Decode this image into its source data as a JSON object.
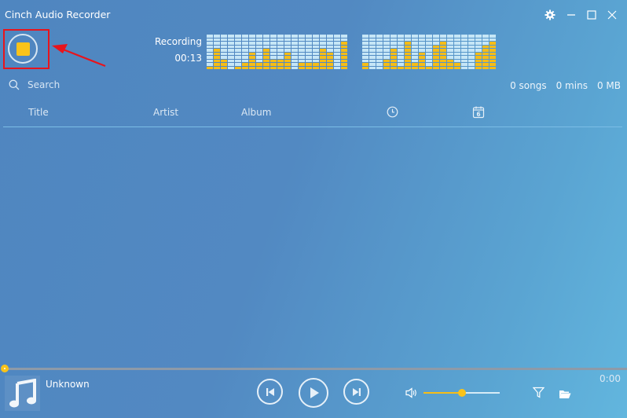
{
  "window": {
    "title": "Cinch Audio Recorder",
    "controls": [
      "settings-icon",
      "minimize-icon",
      "maximize-icon",
      "close-icon"
    ]
  },
  "recorder": {
    "status_label": "Recording",
    "elapsed": "00:13",
    "stop_button_icon": "stop-icon",
    "annotation": "red-highlight-box-with-arrow"
  },
  "meters": {
    "segments_per_column": 10,
    "left_levels": [
      1,
      6,
      3,
      0,
      1,
      2,
      5,
      2,
      6,
      3,
      3,
      5,
      0,
      2,
      2,
      2,
      6,
      5,
      0,
      8
    ],
    "right_levels": [
      2,
      0,
      0,
      3,
      6,
      1,
      8,
      2,
      5,
      1,
      7,
      8,
      3,
      2,
      0,
      0,
      5,
      7,
      8
    ],
    "colors": {
      "on": "#f6bd17",
      "off": "#c6e6f6"
    }
  },
  "search": {
    "placeholder": "Search",
    "icon": "search-icon"
  },
  "stats": {
    "songs": "0 songs",
    "mins": "0 mins",
    "size": "0 MB"
  },
  "columns": {
    "title": "Title",
    "artist": "Artist",
    "album": "Album",
    "duration_icon": "clock-icon",
    "date_icon": "calendar-icon",
    "calendar_day": "6"
  },
  "player": {
    "track_name": "Unknown",
    "time": "0:00",
    "progress_percent": 0,
    "volume_percent": 50,
    "accent_color": "#f9c31a",
    "buttons": [
      "previous",
      "play",
      "next"
    ]
  }
}
